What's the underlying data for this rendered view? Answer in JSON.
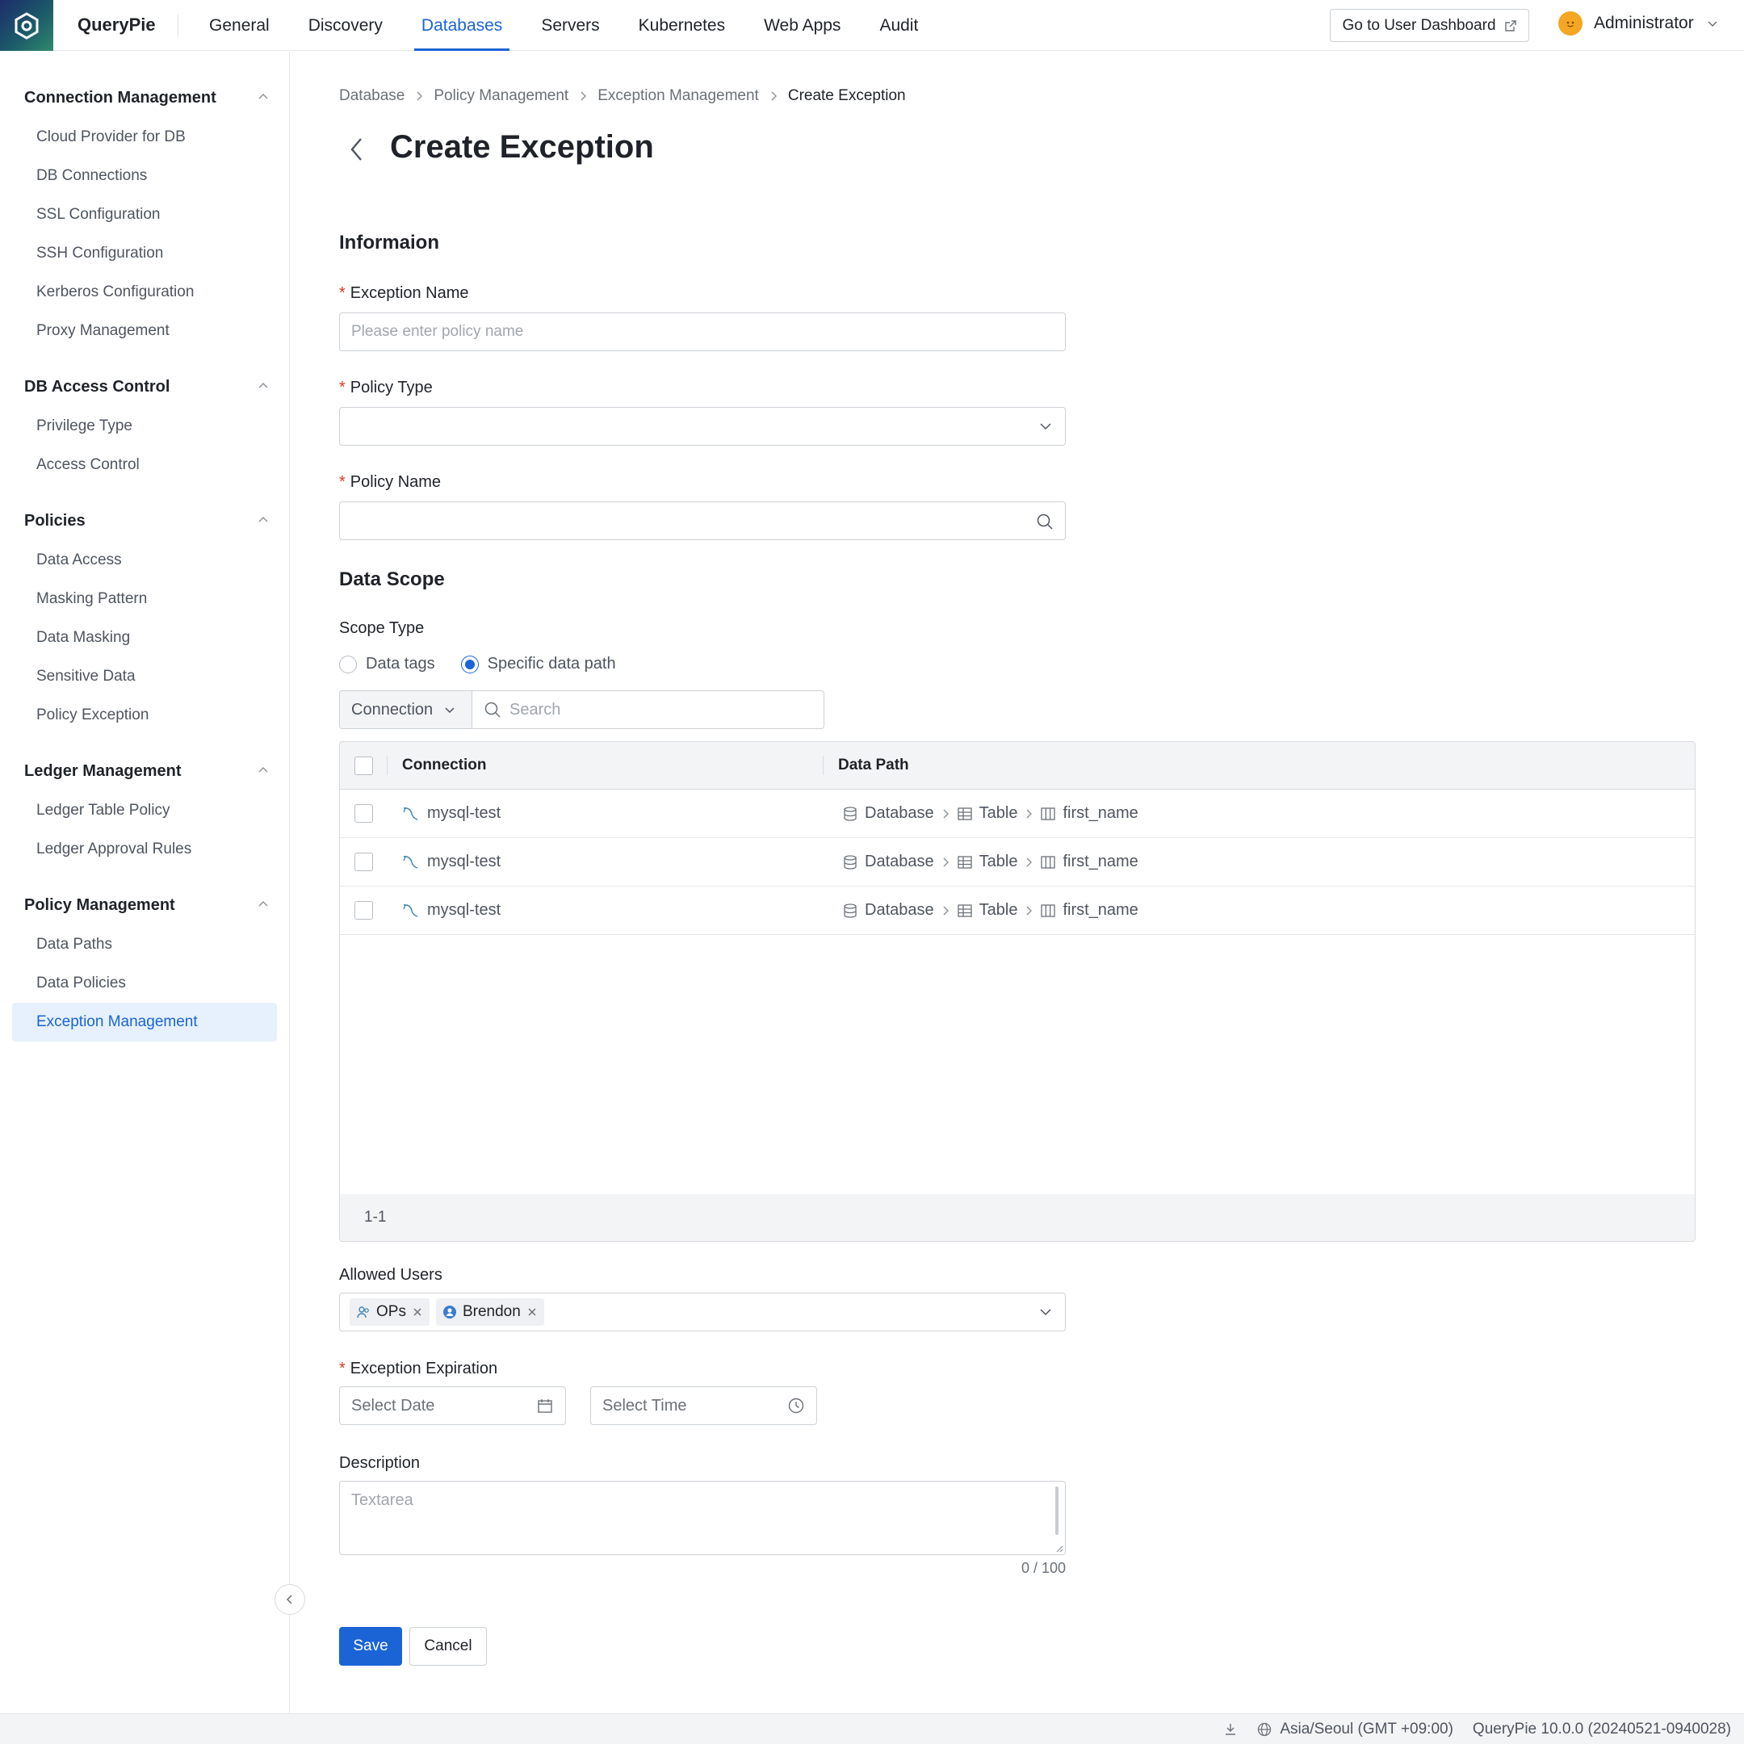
{
  "app": {
    "name": "QueryPie"
  },
  "nav": {
    "items": [
      "General",
      "Discovery",
      "Databases",
      "Servers",
      "Kubernetes",
      "Web Apps",
      "Audit"
    ],
    "active": "Databases"
  },
  "header": {
    "dashboard_button": "Go to User Dashboard",
    "user_name": "Administrator"
  },
  "sidebar": {
    "groups": [
      {
        "title": "Connection Management",
        "items": [
          "Cloud Provider for DB",
          "DB Connections",
          "SSL Configuration",
          "SSH Configuration",
          "Kerberos Configuration",
          "Proxy Management"
        ]
      },
      {
        "title": "DB Access Control",
        "items": [
          "Privilege Type",
          "Access Control"
        ]
      },
      {
        "title": "Policies",
        "items": [
          "Data Access",
          "Masking Pattern",
          "Data Masking",
          "Sensitive Data",
          "Policy Exception"
        ]
      },
      {
        "title": "Ledger Management",
        "items": [
          "Ledger Table Policy",
          "Ledger Approval Rules"
        ]
      },
      {
        "title": "Policy Management",
        "items": [
          "Data Paths",
          "Data Policies",
          "Exception Management"
        ]
      }
    ],
    "active_item": "Exception Management"
  },
  "breadcrumb": [
    "Database",
    "Policy Management",
    "Exception Management",
    "Create Exception"
  ],
  "page": {
    "title": "Create Exception"
  },
  "form": {
    "info_section": "Informaion",
    "exception_name": {
      "label": "Exception Name",
      "placeholder": "Please enter policy name",
      "value": ""
    },
    "policy_type": {
      "label": "Policy Type",
      "value": ""
    },
    "policy_name": {
      "label": "Policy Name",
      "value": ""
    },
    "scope_section": "Data Scope",
    "scope_type": {
      "label": "Scope Type",
      "options": [
        "Data tags",
        "Specific data path"
      ],
      "selected": "Specific data path"
    },
    "filter": {
      "select_value": "Connection",
      "search_placeholder": "Search"
    },
    "table": {
      "columns": [
        "Connection",
        "Data Path"
      ],
      "rows": [
        {
          "connection": "mysql-test",
          "path": [
            "Database",
            "Table",
            "first_name"
          ]
        },
        {
          "connection": "mysql-test",
          "path": [
            "Database",
            "Table",
            "first_name"
          ]
        },
        {
          "connection": "mysql-test",
          "path": [
            "Database",
            "Table",
            "first_name"
          ]
        }
      ],
      "pagination": "1-1"
    },
    "allowed_users": {
      "label": "Allowed Users",
      "tags": [
        "OPs",
        "Brendon"
      ]
    },
    "expiration": {
      "label": "Exception Expiration",
      "date_placeholder": "Select Date",
      "time_placeholder": "Select Time"
    },
    "description": {
      "label": "Description",
      "placeholder": "Textarea",
      "counter": "0 / 100"
    },
    "save_label": "Save",
    "cancel_label": "Cancel"
  },
  "status": {
    "timezone": "Asia/Seoul (GMT +09:00)",
    "version": "QueryPie 10.0.0 (20240521-0940028)"
  },
  "colors": {
    "accent": "#1a64d6",
    "required": "#e0352b"
  }
}
